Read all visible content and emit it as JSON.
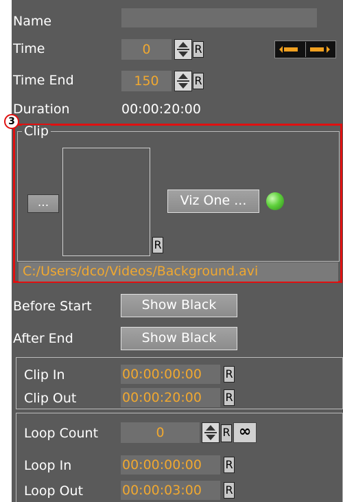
{
  "fields": {
    "name_label": "Name",
    "time_label": "Time",
    "time_value": "0",
    "time_end_label": "Time End",
    "time_end_value": "150",
    "duration_label": "Duration",
    "duration_value": "00:00:20:00",
    "reset_label": "R"
  },
  "callout": {
    "number": "3",
    "color": "#e01010"
  },
  "clip": {
    "group_label": "Clip",
    "browse_label": "...",
    "viz_one_label": "Viz One ...",
    "reset_label": "R",
    "path": "C:/Users/dco/Videos/Background.avi",
    "status_color": "#5fd13c"
  },
  "before_start": {
    "label": "Before Start",
    "value": "Show Black"
  },
  "after_end": {
    "label": "After End",
    "value": "Show Black"
  },
  "clip_range": {
    "clip_in_label": "Clip In",
    "clip_in_value": "00:00:00:00",
    "clip_out_label": "Clip Out",
    "clip_out_value": "00:00:20:00",
    "reset_label": "R"
  },
  "loop": {
    "count_label": "Loop Count",
    "count_value": "0",
    "infinity_label": "∞",
    "loop_in_label": "Loop In",
    "loop_in_value": "00:00:00:00",
    "loop_out_label": "Loop Out",
    "loop_out_value": "00:00:03:00",
    "reset_label": "R"
  },
  "colors": {
    "panel": "#5a5a5a",
    "accent": "#f0a830",
    "toggle_accent": "#f0a020"
  }
}
